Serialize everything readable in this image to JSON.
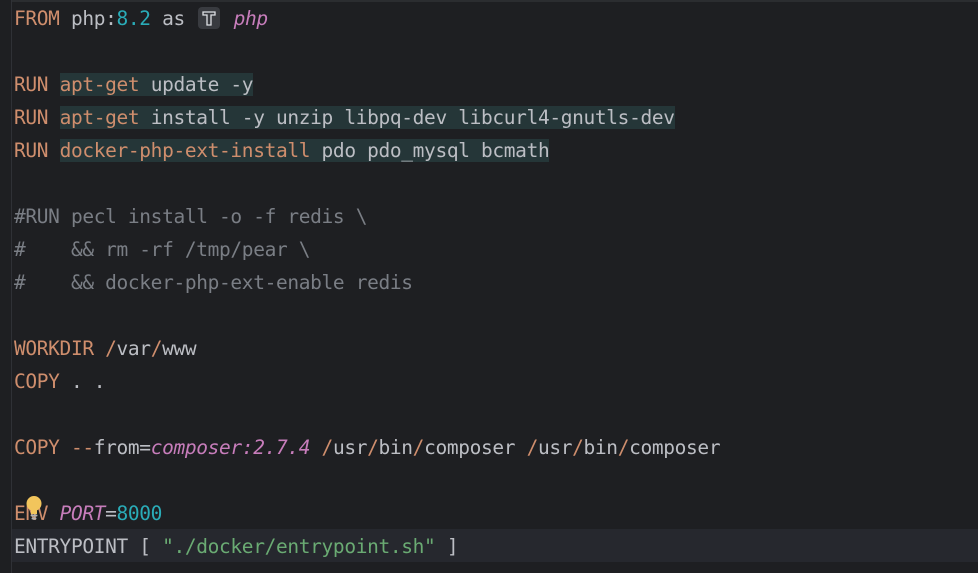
{
  "editor": {
    "language": "Dockerfile",
    "lines": {
      "l1": {
        "kw": "FROM",
        "image": "php:",
        "tag": "8.2",
        "as": "as",
        "alias": "php"
      },
      "l2": {
        "kw": "RUN",
        "cmd": "apt-get",
        "rest": "update -y"
      },
      "l3": {
        "kw": "RUN",
        "cmd": "apt-get",
        "rest": "install -y unzip libpq-dev libcurl4-gnutls-dev"
      },
      "l4": {
        "kw": "RUN",
        "cmd": "docker-php-ext-install",
        "rest": "pdo pdo_mysql bcmath"
      },
      "c1": "#RUN pecl install -o -f redis \\",
      "c2": "#    && rm -rf /tmp/pear \\",
      "c3": "#    && docker-php-ext-enable redis",
      "l5": {
        "kw": "WORKDIR",
        "slash1": "/",
        "p1": "var",
        "slash2": "/",
        "p2": "www"
      },
      "l6": {
        "kw": "COPY",
        "rest": ". ."
      },
      "l7": {
        "kw": "COPY",
        "flag": "--",
        "flagname": "from",
        "eq": "=",
        "src": "composer:2.7.4",
        "sp": " ",
        "s1": "/",
        "a1": "usr",
        "s2": "/",
        "a2": "bin",
        "s3": "/",
        "a3": "composer",
        "sp2": " ",
        "s4": "/",
        "b1": "usr",
        "s5": "/",
        "b2": "bin",
        "s6": "/",
        "b3": "composer"
      },
      "l8": {
        "kw": "ENV",
        "var": "PORT",
        "eq": "=",
        "val": "8000"
      },
      "l9": {
        "kw": "ENTRYPOINT",
        "open": "[",
        "str": "\"./docker/entrypoint.sh\"",
        "close": "]"
      }
    },
    "colors": {
      "background": "#1e1f22",
      "keyword": "#cf8e6d",
      "number": "#2aacb8",
      "string": "#6aab73",
      "parameter": "#c77dbb",
      "comment": "#7a7e85",
      "highlight": "#253638"
    },
    "icons": [
      "hammer-icon",
      "lightbulb-icon"
    ]
  }
}
